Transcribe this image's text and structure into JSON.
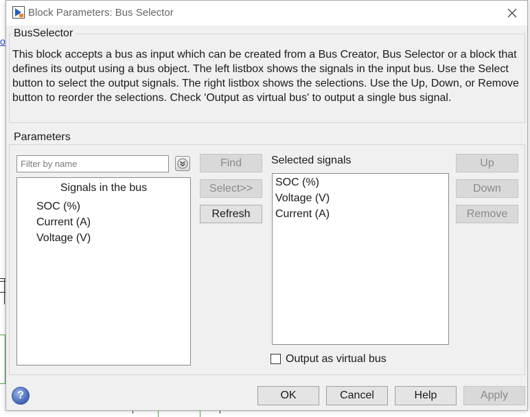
{
  "window": {
    "title": "Block Parameters: Bus Selector",
    "icon": "simulink-block-icon",
    "close_icon": "close-icon"
  },
  "block_group": {
    "label": "BusSelector",
    "description": "This block accepts a bus as input which can be created from a Bus Creator, Bus Selector or a block that defines its output using a bus object. The left listbox shows the signals in the input bus. Use the Select button to select the output signals. The right listbox shows the selections. Use the Up, Down, or Remove button to reorder the selections. Check 'Output as virtual bus' to output a single bus signal."
  },
  "parameters_group": {
    "label": "Parameters",
    "filter": {
      "value": "",
      "placeholder": "Filter by name"
    },
    "filter_options_icon": "chevron-double-down-icon",
    "signals_list": {
      "header": "Signals in the bus",
      "items": [
        "SOC (%)",
        "Current (A)",
        "Voltage (V)"
      ]
    },
    "buttons": {
      "find": "Find",
      "select": "Select>>",
      "refresh": "Refresh",
      "up": "Up",
      "down": "Down",
      "remove": "Remove"
    },
    "selected_label": "Selected signals",
    "selected_list": {
      "items": [
        "SOC (%)",
        "Voltage (V)",
        "Current (A)"
      ]
    },
    "output_virtual_bus": {
      "label": "Output as virtual bus",
      "checked": false
    }
  },
  "footer": {
    "help_icon": "help-icon",
    "ok": "OK",
    "cancel": "Cancel",
    "help": "Help",
    "apply": "Apply"
  },
  "colors": {
    "dialog_bg": "#f0f0f0",
    "disabled_text": "#8a8a8a",
    "background_link": "#1a3fd1",
    "background_wire": "#4aa84a"
  }
}
